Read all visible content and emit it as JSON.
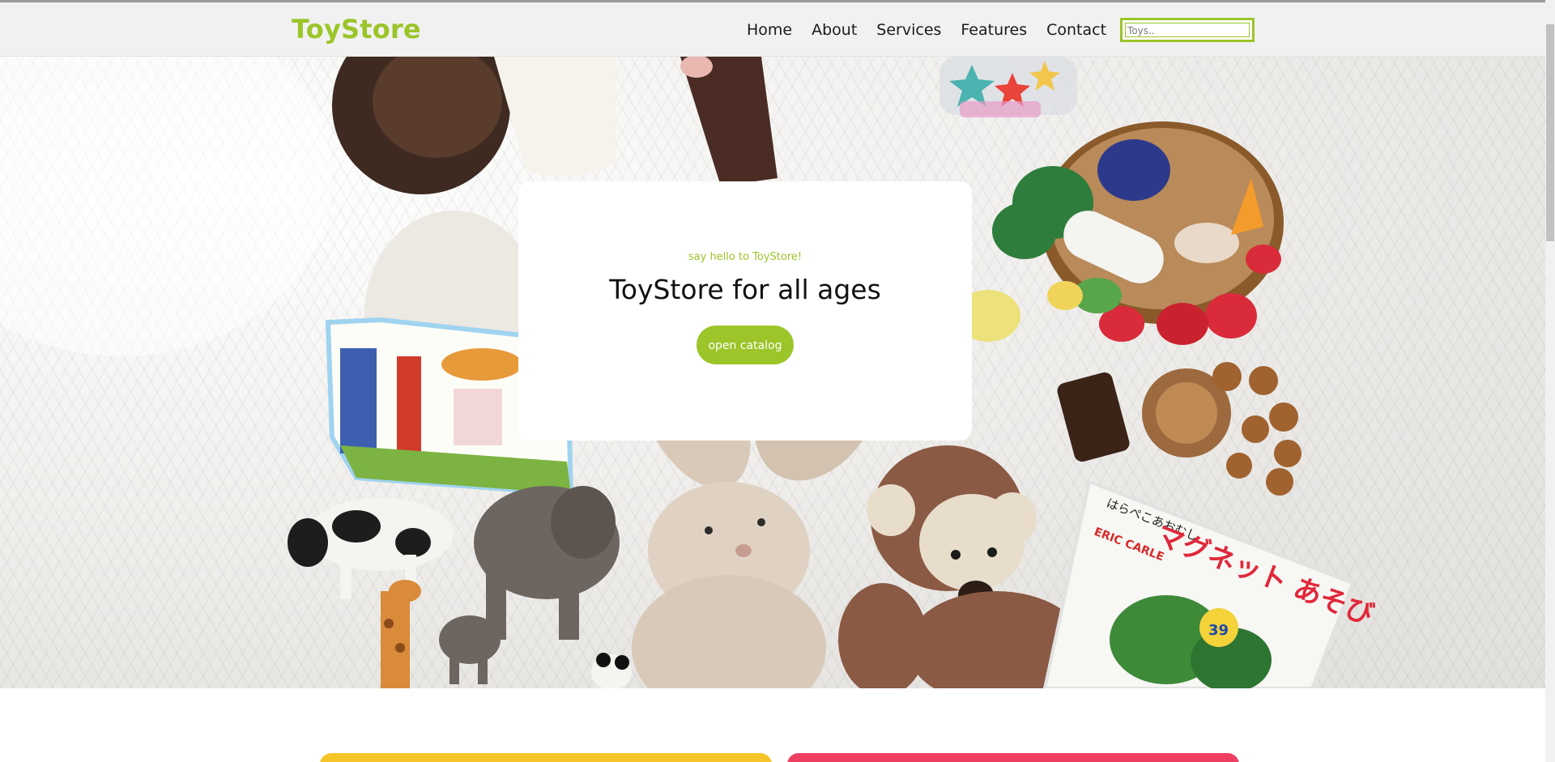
{
  "header": {
    "brand": "ToyStore",
    "nav": [
      "Home",
      "About",
      "Services",
      "Features",
      "Contact"
    ],
    "search_placeholder": "Toys.."
  },
  "hero": {
    "subtitle": "say hello to ToyStore!",
    "title": "ToyStore for all ages",
    "button_label": "open catalog",
    "book_title": "はらぺこあおむし",
    "book_brand": "ERIC CARLE",
    "book_big_text": "マグネット あそび",
    "book_price": "39"
  },
  "colors": {
    "accent": "#9bc529",
    "card_yellow": "#f7c52a",
    "card_pink": "#ee3e62"
  }
}
